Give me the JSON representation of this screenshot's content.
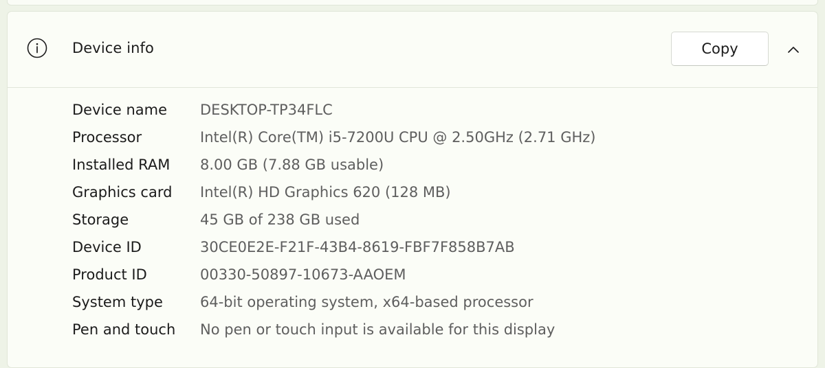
{
  "section": {
    "icon": "info-circle-icon",
    "title": "Device info",
    "copy_label": "Copy",
    "collapse_icon": "chevron-up-icon"
  },
  "specs": [
    {
      "label": "Device name",
      "value": "DESKTOP-TP34FLC"
    },
    {
      "label": "Processor",
      "value": "Intel(R) Core(TM) i5-7200U CPU @ 2.50GHz (2.71 GHz)"
    },
    {
      "label": "Installed RAM",
      "value": "8.00 GB (7.88 GB usable)"
    },
    {
      "label": "Graphics card",
      "value": "Intel(R) HD Graphics 620 (128 MB)"
    },
    {
      "label": "Storage",
      "value": "45 GB of 238 GB used"
    },
    {
      "label": "Device ID",
      "value": "30CE0E2E-F21F-43B4-8619-FBF7F858B7AB"
    },
    {
      "label": "Product ID",
      "value": "00330-50897-10673-AAOEM"
    },
    {
      "label": "System type",
      "value": "64-bit operating system, x64-based processor"
    },
    {
      "label": "Pen and touch",
      "value": "No pen or touch input is available for this display"
    }
  ],
  "colors": {
    "background": "#eef3e7",
    "card": "#fbfdf7",
    "label_text": "#1b1b1b",
    "value_text": "#5e5e5e"
  }
}
